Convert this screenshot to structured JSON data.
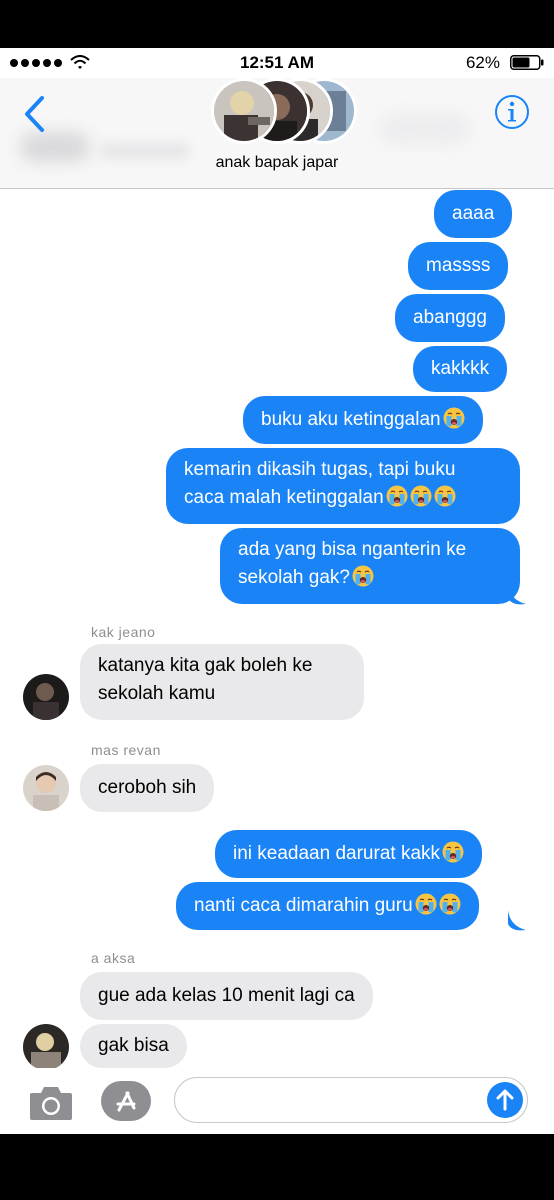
{
  "status_bar": {
    "time": "12:51 AM",
    "battery": "62%"
  },
  "header": {
    "group_name": "anak bapak japar"
  },
  "messages": [
    {
      "dir": "out",
      "text": "aaaa"
    },
    {
      "dir": "out",
      "text": "massss"
    },
    {
      "dir": "out",
      "text": "abanggg"
    },
    {
      "dir": "out",
      "text": "kakkkk"
    },
    {
      "dir": "out",
      "text": "buku aku ketinggalan",
      "emoji": "loudly-crying-face"
    },
    {
      "dir": "out",
      "line1": "kemarin dikasih tugas, tapi buku",
      "line2": "caca malah ketinggalan",
      "emoji": "loudly-crying-face x3"
    },
    {
      "dir": "out",
      "line1": "ada yang bisa nganterin ke",
      "line2": "sekolah gak?",
      "emoji": "loudly-crying-face"
    },
    {
      "dir": "in",
      "sender": "kak jeano",
      "line1": "katanya kita gak boleh ke",
      "line2": "sekolah kamu"
    },
    {
      "dir": "in",
      "sender": "mas revan",
      "text": "ceroboh sih"
    },
    {
      "dir": "out",
      "text": "ini keadaan darurat kakk",
      "emoji": "loudly-crying-face"
    },
    {
      "dir": "out",
      "text": "nanti caca dimarahin guru",
      "emoji": "loudly-crying-face x2"
    },
    {
      "dir": "in",
      "sender": "a aksa",
      "text": "gue ada kelas 10 menit lagi ca"
    },
    {
      "dir": "in",
      "text": "gak bisa"
    }
  ],
  "input_bar": {
    "placeholder": ""
  },
  "colors": {
    "outgoing": "#1a84f7",
    "incoming": "#e9e9eb",
    "accent": "#1a84f7"
  }
}
